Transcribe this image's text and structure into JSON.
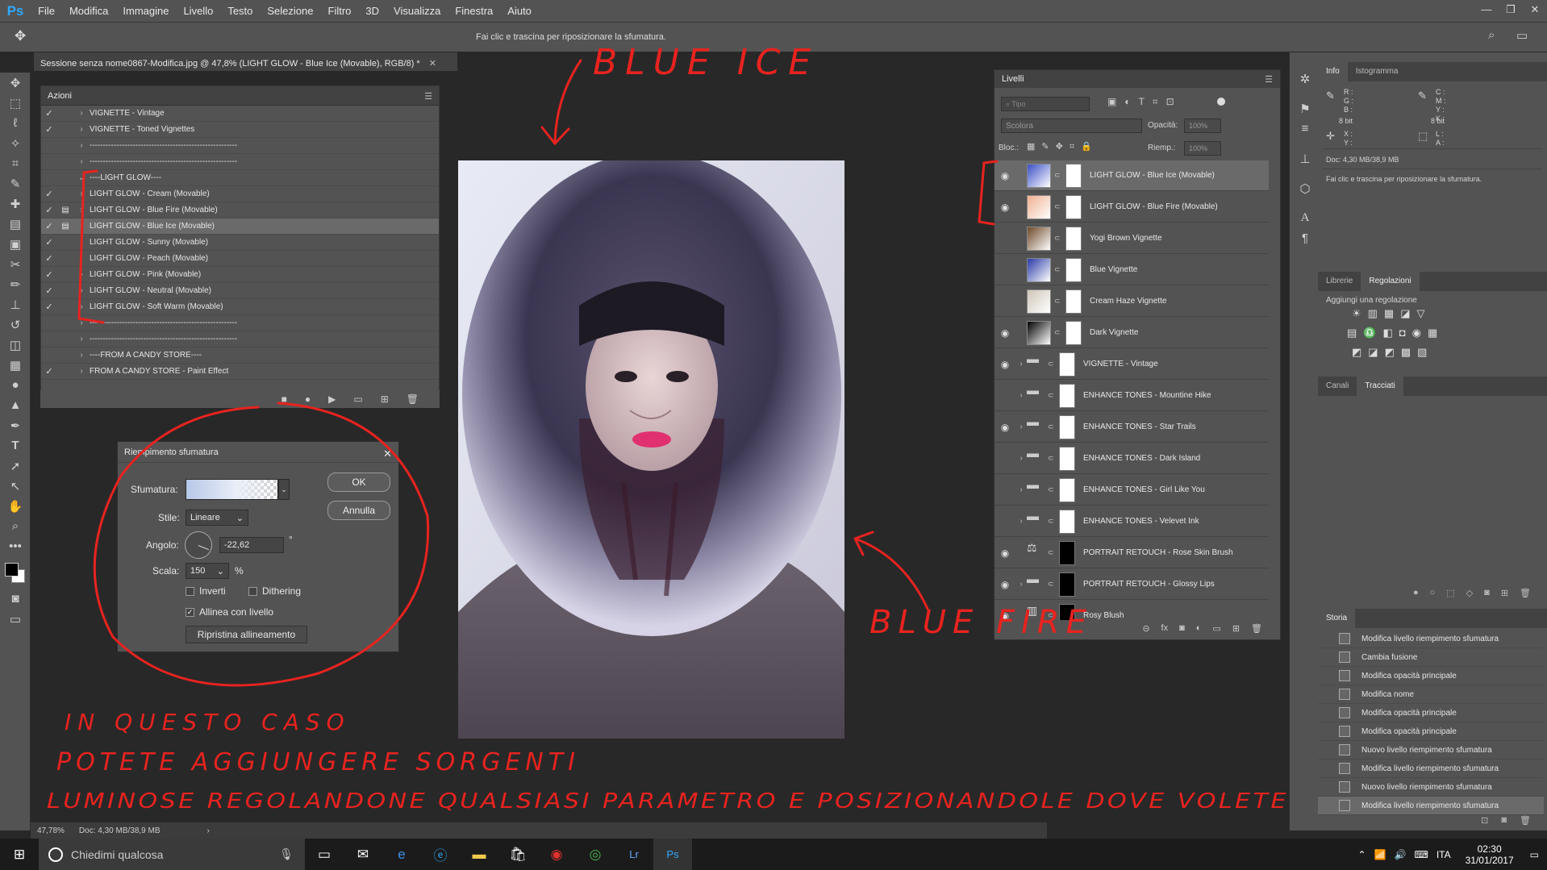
{
  "app": {
    "logo": "Ps"
  },
  "menu": [
    "File",
    "Modifica",
    "Immagine",
    "Livello",
    "Testo",
    "Selezione",
    "Filtro",
    "3D",
    "Visualizza",
    "Finestra",
    "Aiuto"
  ],
  "options_bar": {
    "hint": "Fai clic e trascina per riposizionare la sfumatura."
  },
  "document": {
    "tab_title": "Sessione senza nome0867-Modifica.jpg @ 47,8% (LIGHT GLOW - Blue Ice (Movable), RGB/8) *"
  },
  "actions_panel": {
    "title": "Azioni",
    "rows": [
      {
        "label": "VIGNETTE - Vintage",
        "checked": true
      },
      {
        "label": "VIGNETTE - Toned Vignettes",
        "checked": true
      },
      {
        "label": "-------------------------------------------------------",
        "checked": false
      },
      {
        "label": "-------------------------------------------------------",
        "checked": false
      },
      {
        "label": "----LIGHT GLOW----",
        "checked": false
      },
      {
        "label": "LIGHT GLOW - Cream (Movable)",
        "checked": true
      },
      {
        "label": "LIGHT GLOW - Blue Fire (Movable)",
        "checked": true
      },
      {
        "label": "LIGHT GLOW - Blue Ice (Movable)",
        "checked": true
      },
      {
        "label": "LIGHT GLOW - Sunny (Movable)",
        "checked": true
      },
      {
        "label": "LIGHT GLOW - Peach (Movable)",
        "checked": true
      },
      {
        "label": "LIGHT GLOW - Pink (Movable)",
        "checked": true
      },
      {
        "label": "LIGHT GLOW - Neutral (Movable)",
        "checked": true
      },
      {
        "label": "LIGHT GLOW - Soft Warm (Movable)",
        "checked": true
      },
      {
        "label": "-------------------------------------------------------",
        "checked": false
      },
      {
        "label": "-------------------------------------------------------",
        "checked": false
      },
      {
        "label": "----FROM A CANDY STORE----",
        "checked": false
      },
      {
        "label": "FROM A CANDY STORE - Paint Effect",
        "checked": true
      }
    ]
  },
  "gradient_dialog": {
    "title": "Riempimento sfumatura",
    "gradient_label": "Sfumatura:",
    "style_label": "Stile:",
    "style_value": "Lineare",
    "angle_label": "Angolo:",
    "angle_value": "-22,62",
    "degree": "°",
    "scale_label": "Scala:",
    "scale_value": "150",
    "percent": "%",
    "invert_label": "Inverti",
    "dither_label": "Dithering",
    "align_label": "Allinea con livello",
    "reset_label": "Ripristina allineamento",
    "ok": "OK",
    "cancel": "Annulla"
  },
  "layers_panel": {
    "title": "Livelli",
    "filter_placeholder": "Tipo",
    "blend": "Scolora",
    "opacity_label": "Opacità:",
    "opacity_value": "100%",
    "lock_label": "Bloc.:",
    "fill_label": "Riemp.:",
    "fill_value": "100%",
    "rows": [
      {
        "name": "LIGHT GLOW - Blue Ice (Movable)",
        "visible": true,
        "kind": "gradient"
      },
      {
        "name": "LIGHT GLOW - Blue Fire (Movable)",
        "visible": true,
        "kind": "gradient"
      },
      {
        "name": "Yogi Brown Vignette",
        "visible": false,
        "kind": "gradient"
      },
      {
        "name": "Blue Vignette",
        "visible": false,
        "kind": "gradient"
      },
      {
        "name": "Cream Haze Vignette",
        "visible": false,
        "kind": "gradient"
      },
      {
        "name": "Dark Vignette",
        "visible": true,
        "kind": "gradient"
      },
      {
        "name": "VIGNETTE - Vintage",
        "visible": true,
        "kind": "group"
      },
      {
        "name": "ENHANCE TONES - Mountine Hike",
        "visible": false,
        "kind": "group"
      },
      {
        "name": "ENHANCE TONES - Star Trails",
        "visible": true,
        "kind": "group"
      },
      {
        "name": "ENHANCE TONES - Dark Island",
        "visible": false,
        "kind": "group"
      },
      {
        "name": "ENHANCE TONES - Girl Like You",
        "visible": false,
        "kind": "group"
      },
      {
        "name": "ENHANCE TONES - Velevet Ink",
        "visible": false,
        "kind": "group"
      },
      {
        "name": "PORTRAIT RETOUCH - Rose Skin Brush",
        "visible": true,
        "kind": "adjust"
      },
      {
        "name": "PORTRAIT RETOUCH - Glossy Lips",
        "visible": true,
        "kind": "group"
      },
      {
        "name": "Rosy Blush",
        "visible": true,
        "kind": "adjust"
      }
    ]
  },
  "info_panel": {
    "tabs": [
      "Info",
      "Istogramma"
    ],
    "bits_left": "8 bit",
    "bits_right": "8 bit",
    "doc_size": "Doc: 4,30 MB/38,9 MB",
    "hint": "Fai clic e trascina per riposizionare la sfumatura."
  },
  "adjust_panel": {
    "tabs": [
      "Librerie",
      "Regolazioni"
    ],
    "heading": "Aggiungi una regolazione"
  },
  "channels_panel": {
    "tabs": [
      "Canali",
      "Tracciati"
    ]
  },
  "history_panel": {
    "title": "Storia",
    "rows": [
      "Modifica livello riempimento sfumatura",
      "Cambia fusione",
      "Modifica opacità principale",
      "Modifica nome",
      "Modifica opacità principale",
      "Modifica opacità principale",
      "Nuovo livello riempimento sfumatura",
      "Modifica livello riempimento sfumatura",
      "Nuovo livello riempimento sfumatura",
      "Modifica livello riempimento sfumatura"
    ]
  },
  "status": {
    "zoom": "47,78%",
    "doc": "Doc: 4,30 MB/38,9 MB"
  },
  "annotations": {
    "blue_ice": "BLUE ICE",
    "blue_fire": "BLUE FIRE",
    "line1": "IN QUESTO CASO",
    "line2": "POTETE AGGIUNGERE SORGENTI",
    "line3": "LUMINOSE REGOLANDONE QUALSIASI PARAMETRO E POSIZIONANDOLE DOVE VOLETE"
  },
  "taskbar": {
    "search": "Chiedimi qualcosa",
    "lang": "ITA",
    "time": "02:30",
    "date": "31/01/2017"
  },
  "colors": {
    "ui": "#535353",
    "accent": "#31a8ff",
    "annotation": "#e8231f"
  }
}
